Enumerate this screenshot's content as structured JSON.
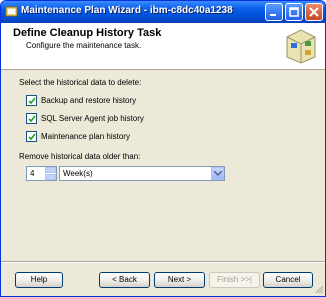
{
  "window": {
    "title": "Maintenance Plan Wizard - ibm-c8dc40a1238"
  },
  "header": {
    "title": "Define Cleanup History Task",
    "subtitle": "Configure the maintenance task."
  },
  "form": {
    "select_label": "Select the historical data to delete:",
    "checkboxes": [
      {
        "label": "Backup and restore history",
        "checked": true
      },
      {
        "label": "SQL Server Agent job history",
        "checked": true
      },
      {
        "label": "Maintenance plan history",
        "checked": true
      }
    ],
    "remove_label": "Remove historical data older than:",
    "age_value": "4",
    "unit_value": "Week(s)"
  },
  "buttons": {
    "help": "Help",
    "back": "< Back",
    "next": "Next >",
    "finish": "Finish >>|",
    "cancel": "Cancel"
  },
  "colors": {
    "titlebar": "#0a5fe8",
    "window_bg": "#ece9d8"
  }
}
